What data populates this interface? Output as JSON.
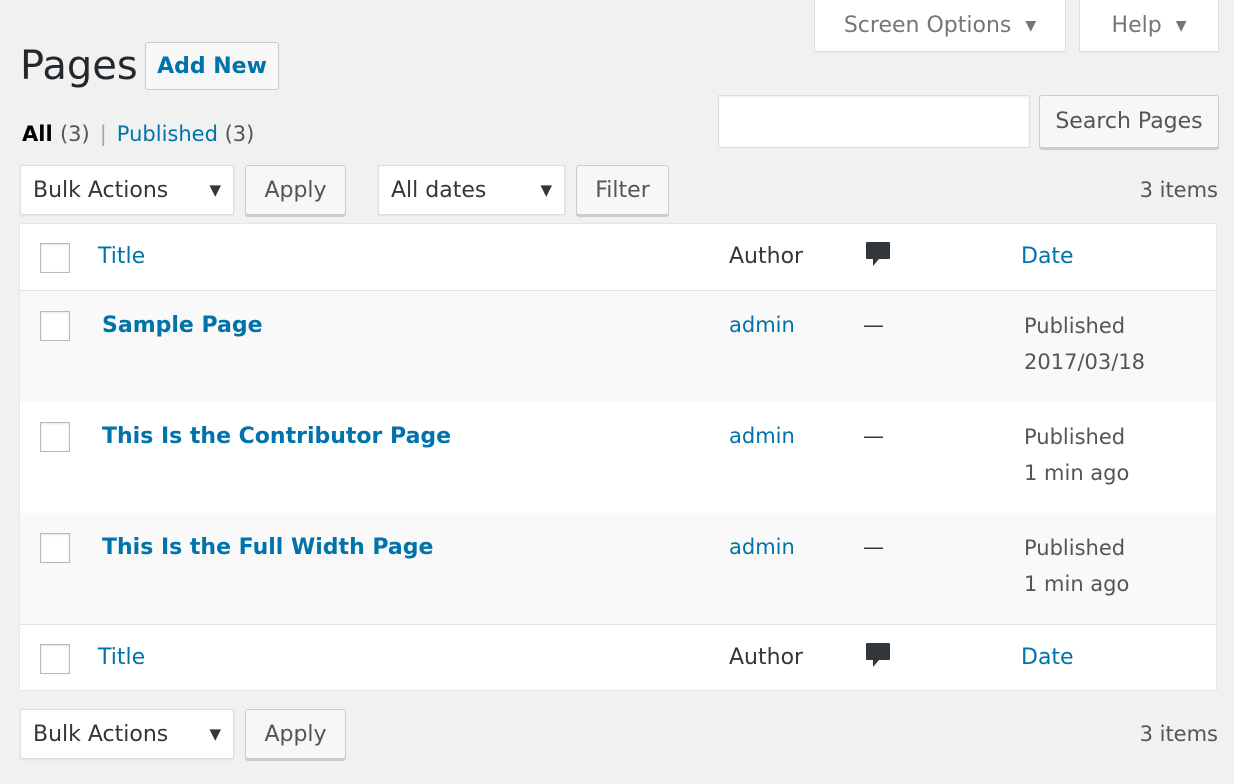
{
  "tabs": {
    "screen_options": "Screen Options",
    "help": "Help"
  },
  "heading": {
    "title": "Pages",
    "add_new": "Add New"
  },
  "views": {
    "all_label": "All",
    "all_count": "(3)",
    "separator": "|",
    "published_label": "Published",
    "published_count": "(3)"
  },
  "search": {
    "value": "",
    "button": "Search Pages"
  },
  "top_nav": {
    "bulk_actions": "Bulk Actions",
    "apply": "Apply",
    "dates": "All dates",
    "filter": "Filter",
    "items": "3 items"
  },
  "bottom_nav": {
    "bulk_actions": "Bulk Actions",
    "apply": "Apply",
    "items": "3 items"
  },
  "table": {
    "columns": {
      "title": "Title",
      "author": "Author",
      "comments_icon": "comment-bubble-icon",
      "date": "Date"
    },
    "rows": [
      {
        "title": "Sample Page",
        "author": "admin",
        "comments": "—",
        "status": "Published",
        "date": "2017/03/18"
      },
      {
        "title": "This Is the Contributor Page",
        "author": "admin",
        "comments": "—",
        "status": "Published",
        "date": "1 min ago"
      },
      {
        "title": "This Is the Full Width Page",
        "author": "admin",
        "comments": "—",
        "status": "Published",
        "date": "1 min ago"
      }
    ]
  },
  "colors": {
    "link": "#0073aa",
    "background": "#f1f1f1",
    "text": "#23282d"
  }
}
